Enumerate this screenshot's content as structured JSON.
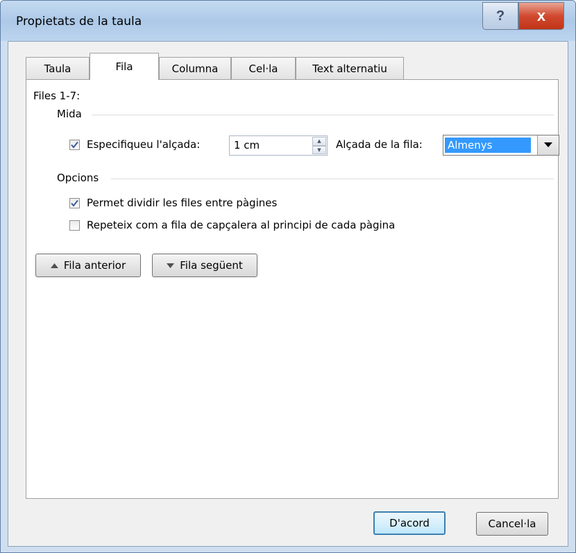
{
  "window": {
    "title": "Propietats de la taula",
    "help_glyph": "?",
    "close_glyph": "x"
  },
  "tabs": [
    {
      "label": "Taula",
      "active": false
    },
    {
      "label": "Fila",
      "active": true
    },
    {
      "label": "Columna",
      "active": false
    },
    {
      "label": "Cel·la",
      "active": false
    },
    {
      "label": "Text alternatiu",
      "active": false
    }
  ],
  "fila": {
    "heading": "Files 1-7:",
    "mida_section": "Mida",
    "specify_height_label": "Especifiqueu l'alçada:",
    "specify_height_checked": true,
    "height_value": "1 cm",
    "row_height_label": "Alçada de la fila:",
    "row_height_selected": "Almenys",
    "options_section": "Opcions",
    "allow_break_label": "Permet dividir les files entre pàgines",
    "allow_break_checked": true,
    "repeat_header_label": "Repeteix com a fila de capçalera al principi de cada pàgina",
    "repeat_header_checked": false,
    "prev_row_button": "Fila anterior",
    "next_row_button": "Fila següent"
  },
  "footer": {
    "ok_button": "D'acord",
    "cancel_button": "Cancel·la"
  },
  "colors": {
    "titlebar": "#b9d1ea",
    "selection": "#3399ff",
    "close_button": "#c94a2e",
    "default_button_border": "#3c7fb1"
  },
  "icons": {
    "check": "check-icon",
    "spin_up": "spin-up-icon",
    "spin_down": "spin-down-icon",
    "dropdown": "dropdown-arrow-icon",
    "prev": "triangle-up-icon",
    "next": "triangle-down-icon"
  }
}
